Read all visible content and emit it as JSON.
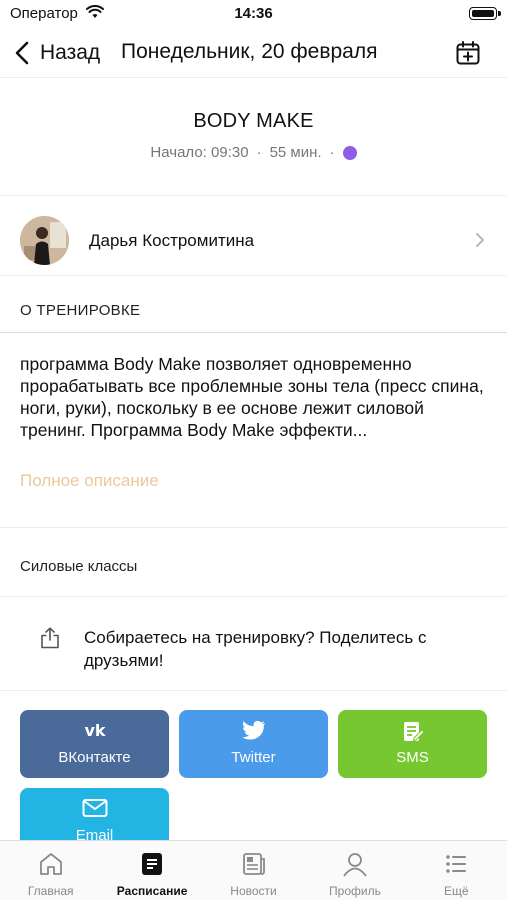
{
  "status_bar": {
    "carrier": "Оператор",
    "time": "14:36"
  },
  "nav": {
    "back_label": "Назад",
    "title": "Понедельник, 20 февраля",
    "calendar_icon": "calendar-add-icon"
  },
  "class": {
    "title": "BODY MAKE",
    "start": "Начало: 09:30",
    "separator": "·",
    "duration": "55 мин.",
    "color": "#8e5ee6"
  },
  "trainer": {
    "name": "Дарья Костромитина"
  },
  "about": {
    "section_label": "О ТРЕНИРОВКЕ",
    "description": "программа Body Make позволяет одновременно прорабатывать все проблемные зоны тела (пресс спина, ноги, руки), поскольку в ее основе лежит силовой тренинг. Программа Body Make эффекти...",
    "full_label": "Полное описание"
  },
  "category": "Силовые классы",
  "share": {
    "text": "Собираетесь на тренировку? Поделитесь с друзьями!",
    "buttons": [
      {
        "label": "ВКонтакте",
        "icon": "vk-icon",
        "color": "#4a6a9a"
      },
      {
        "label": "Twitter",
        "icon": "twitter-icon",
        "color": "#4a9be9"
      },
      {
        "label": "SMS",
        "icon": "sms-icon",
        "color": "#76c730"
      },
      {
        "label": "Email",
        "icon": "envelope-icon",
        "color": "#22b5e4"
      }
    ]
  },
  "tabs": [
    {
      "label": "Главная",
      "icon": "home-icon",
      "active": false
    },
    {
      "label": "Расписание",
      "icon": "schedule-icon",
      "active": true
    },
    {
      "label": "Новости",
      "icon": "news-icon",
      "active": false
    },
    {
      "label": "Профиль",
      "icon": "profile-icon",
      "active": false
    },
    {
      "label": "Ещё",
      "icon": "more-list-icon",
      "active": false
    }
  ]
}
